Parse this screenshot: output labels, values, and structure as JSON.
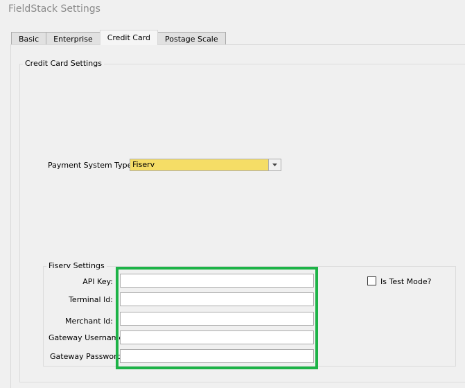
{
  "window": {
    "title": "FieldStack Settings"
  },
  "tabs": [
    {
      "label": "Basic",
      "active": false
    },
    {
      "label": "Enterprise",
      "active": false
    },
    {
      "label": "Credit Card",
      "active": true
    },
    {
      "label": "Postage Scale",
      "active": false
    }
  ],
  "credit_card_group": {
    "title": "Credit Card Settings",
    "payment_system_label": "Payment System Type:",
    "payment_system_value": "Fiserv",
    "payment_system_highlight_color": "#f5dd66"
  },
  "fiserv_group": {
    "title": "Fiserv Settings",
    "fields": [
      {
        "label": "API Key:",
        "value": "",
        "placeholder": ""
      },
      {
        "label": "Terminal Id:",
        "value": "",
        "placeholder": ""
      },
      {
        "label": "Merchant Id:",
        "value": "",
        "placeholder": ""
      },
      {
        "label": "Gateway Username",
        "value": "",
        "placeholder": ""
      },
      {
        "label": "Gateway Password",
        "value": "",
        "placeholder": ""
      }
    ],
    "test_mode_label": "Is Test Mode?",
    "test_mode_checked": false
  },
  "annotation": {
    "highlight_color": "#1db347"
  }
}
